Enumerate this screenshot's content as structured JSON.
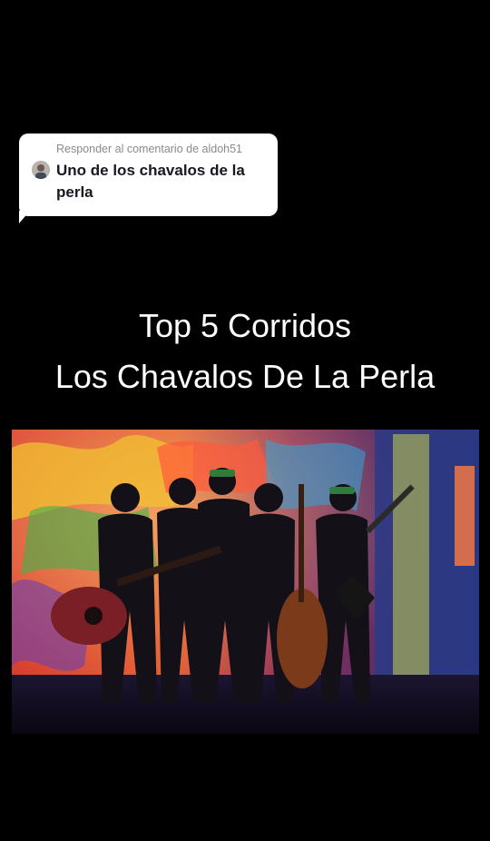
{
  "reply_bubble": {
    "header": "Responder al comentario de aldoh51",
    "text": "Uno de los chavalos de la perla",
    "avatar_icon": "user-avatar"
  },
  "overlay": {
    "line1": "Top 5 Corridos",
    "line2": "Los Chavalos De La Perla"
  },
  "video_frame": {
    "description_icon": "band-photo"
  },
  "colors": {
    "background": "#000000",
    "bubble": "#ffffff",
    "bubble_text": "#161823",
    "bubble_header": "#8a8a8f"
  }
}
